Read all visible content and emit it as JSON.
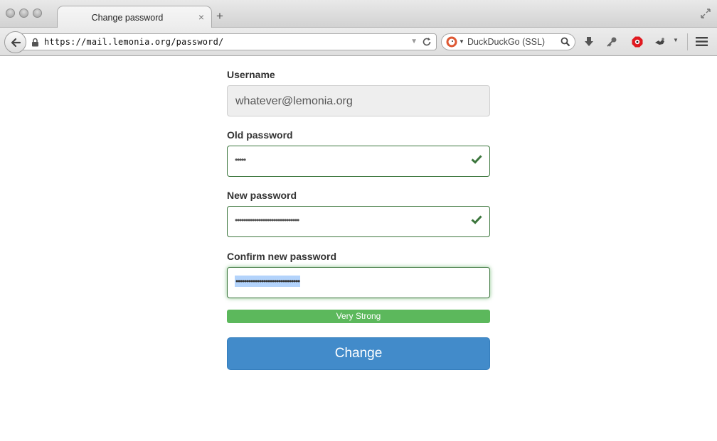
{
  "browser": {
    "tab_title": "Change password",
    "tab_close": "×",
    "new_tab": "+",
    "url": "https://mail.lemonia.org/password/",
    "search_engine": "DuckDuckGo (SSL)"
  },
  "form": {
    "username": {
      "label": "Username",
      "value": "whatever@lemonia.org"
    },
    "old_password": {
      "label": "Old password",
      "masked": "•••••",
      "valid": true
    },
    "new_password": {
      "label": "New password",
      "masked": "••••••••••••••••••••••••••••••",
      "valid": true
    },
    "confirm_password": {
      "label": "Confirm new password",
      "masked": "••••••••••••••••••••••••••••••",
      "selected": true
    },
    "strength": {
      "label": "Very Strong",
      "level": 1.0,
      "color": "#5cb85c"
    },
    "submit_label": "Change"
  },
  "colors": {
    "success": "#3c763d",
    "primary": "#428bca"
  },
  "icons": [
    "back-arrow-icon",
    "lock-icon",
    "reload-icon",
    "duckduckgo-icon",
    "search-icon",
    "download-icon",
    "key-icon",
    "adblock-icon",
    "extension-icon",
    "menu-icon",
    "restore-icon",
    "checkmark-icon"
  ]
}
